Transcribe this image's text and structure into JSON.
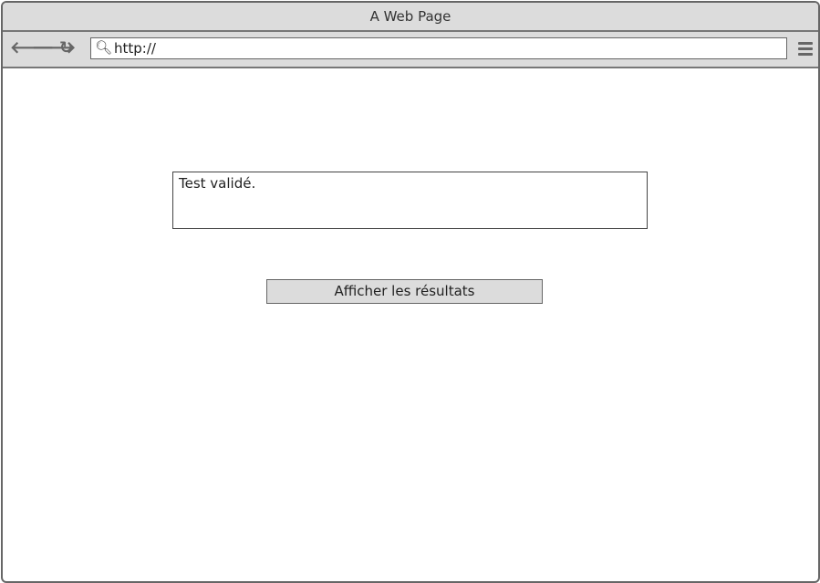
{
  "window": {
    "title": "A Web Page"
  },
  "toolbar": {
    "back_icon": "arrow-left-icon",
    "forward_icon": "arrow-right-icon",
    "reload_icon": "reload-icon",
    "url": "http://",
    "menu_icon": "hamburger-menu-icon"
  },
  "main": {
    "message": "Test validé.",
    "button_label": "Afficher les résultats"
  }
}
